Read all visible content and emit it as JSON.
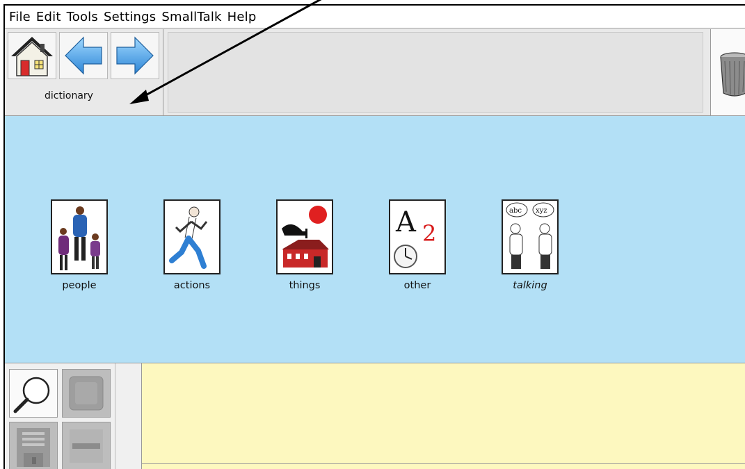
{
  "menubar": {
    "items": [
      "File",
      "Edit",
      "Tools",
      "Settings",
      "SmallTalk",
      "Help"
    ]
  },
  "toolbar": {
    "home_icon": "house-icon",
    "back_icon": "arrow-left-icon",
    "forward_icon": "arrow-right-icon",
    "breadcrumb_label": "dictionary",
    "trash_icon": "trash-can-icon"
  },
  "board": {
    "background_color": "#b3e0f6",
    "tiles": [
      {
        "label": "people",
        "icon": "people-icon",
        "italic": false
      },
      {
        "label": "actions",
        "icon": "runner-icon",
        "italic": false
      },
      {
        "label": "things",
        "icon": "objects-icon",
        "italic": false
      },
      {
        "label": "other",
        "icon": "letters-clock-icon",
        "italic": false
      },
      {
        "label": "talking",
        "icon": "conversation-icon",
        "italic": true
      }
    ]
  },
  "tools": {
    "search_icon": "magnifier-icon",
    "disabled_icons": [
      "blank-square-icon",
      "floppy-disk-icon",
      "minus-icon"
    ]
  },
  "message_area": {
    "background_color": "#fdf8bf"
  },
  "annotation": {
    "arrow": "pointer-arrow"
  }
}
